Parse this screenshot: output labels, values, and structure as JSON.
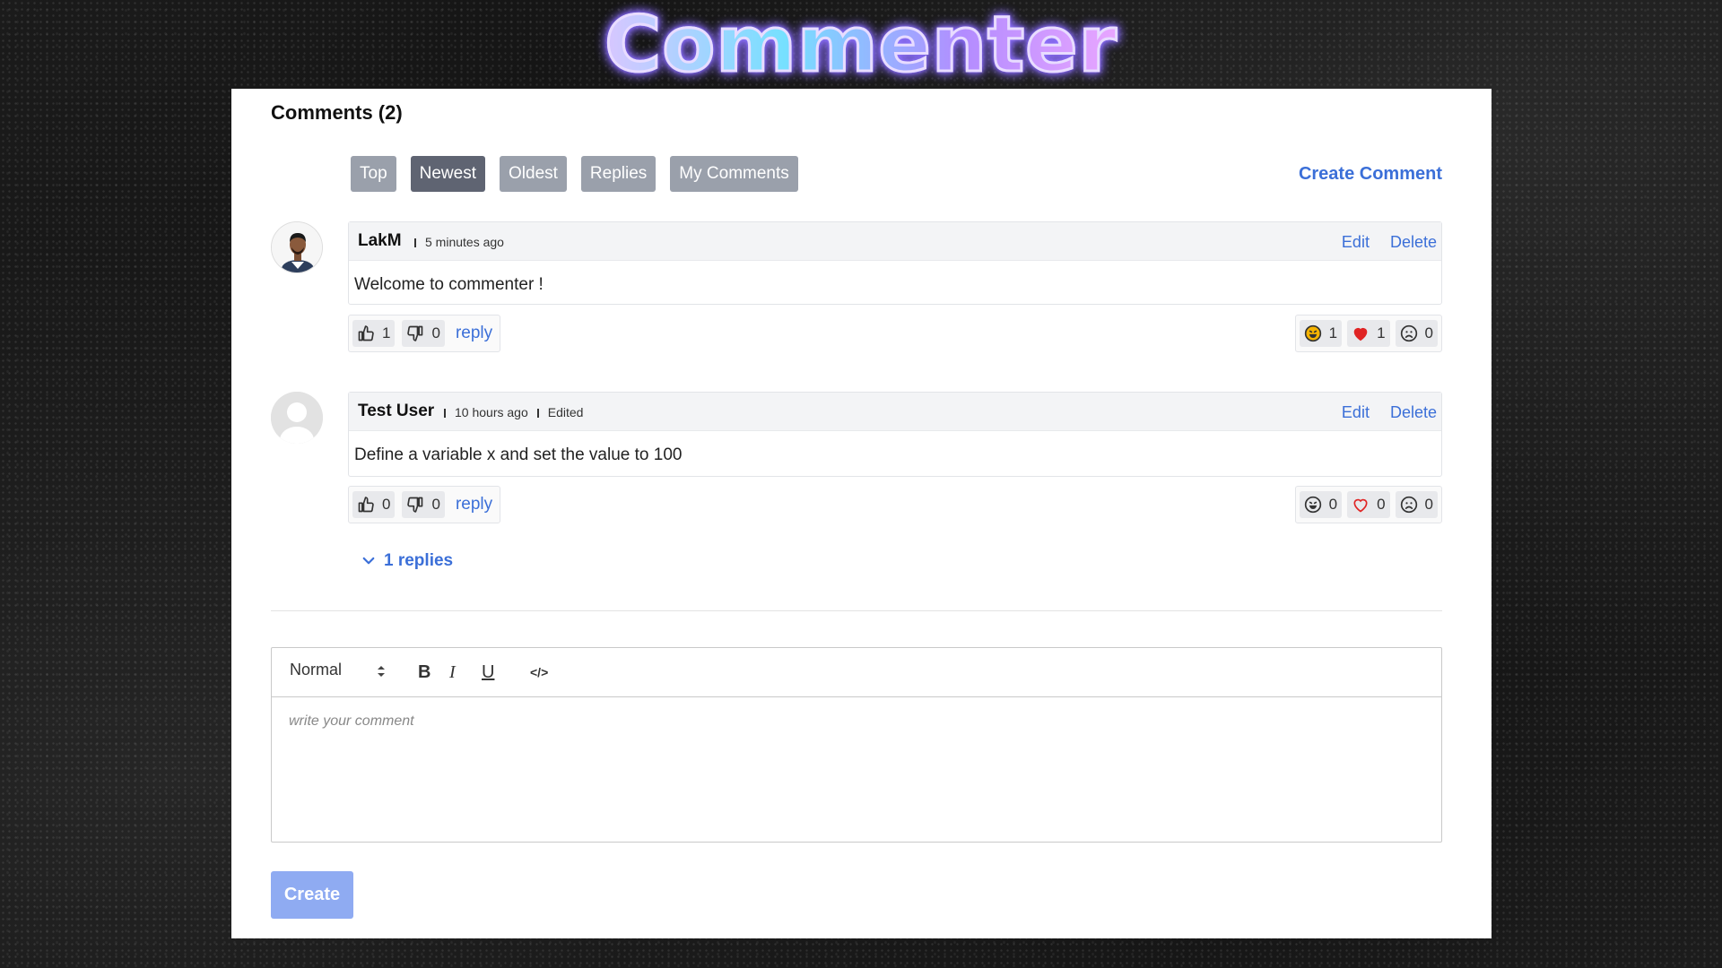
{
  "app": {
    "logo_text": "Commenter"
  },
  "header": {
    "title": "Comments (2)",
    "create_comment_label": "Create Comment"
  },
  "sort_tabs": [
    {
      "label": "Top",
      "active": false
    },
    {
      "label": "Newest",
      "active": true
    },
    {
      "label": "Oldest",
      "active": false
    },
    {
      "label": "Replies",
      "active": false
    },
    {
      "label": "My Comments",
      "active": false
    }
  ],
  "comments": [
    {
      "author": "LakM",
      "time": "5 minutes ago",
      "edited_label": "",
      "body": "Welcome to commenter !",
      "edit_label": "Edit",
      "delete_label": "Delete",
      "likes": "1",
      "dislikes": "0",
      "reply_label": "reply",
      "reactions": {
        "laugh": "1",
        "heart": "1",
        "sad": "0"
      },
      "avatar": "user-photo"
    },
    {
      "author": "Test User",
      "time": "10 hours ago",
      "edited_label": "Edited",
      "body": "Define a variable x and set the value to 100",
      "edit_label": "Edit",
      "delete_label": "Delete",
      "likes": "0",
      "dislikes": "0",
      "reply_label": "reply",
      "reactions": {
        "laugh": "0",
        "heart": "0",
        "sad": "0"
      },
      "replies_label": "1 replies",
      "avatar": "default-avatar"
    }
  ],
  "editor": {
    "format_value": "Normal",
    "bold_label": "B",
    "italic_label": "I",
    "underline_label": "U",
    "code_label": "</>",
    "placeholder": "write your comment",
    "submit_label": "Create"
  },
  "colors": {
    "link": "#3b6fd8",
    "tab": "#9aa0ab",
    "tab_active": "#5f6472",
    "submit": "#8fabf2",
    "heart": "#e02424"
  }
}
